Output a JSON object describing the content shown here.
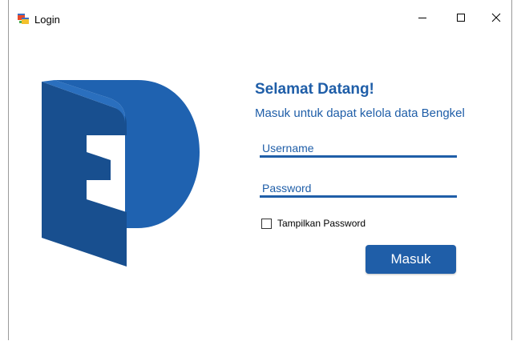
{
  "window": {
    "title": "Login",
    "icon": "app-form-icon",
    "controls": {
      "minimize_icon": "minimize-icon",
      "maximize_icon": "maximize-icon",
      "close_icon": "close-icon"
    }
  },
  "colors": {
    "accent": "#1f5ea8",
    "logo_light": "#1f62b0",
    "logo_dark": "#184f8f"
  },
  "logo": {
    "icon": "brand-logo-icon"
  },
  "form": {
    "welcome": "Selamat Datang!",
    "subtitle": "Masuk untuk dapat kelola data Bengkel",
    "username": {
      "value": "",
      "placeholder": "Username"
    },
    "password": {
      "value": "",
      "placeholder": "Password"
    },
    "show_password": {
      "label": "Tampilkan Password",
      "checked": false
    },
    "submit_label": "Masuk"
  }
}
